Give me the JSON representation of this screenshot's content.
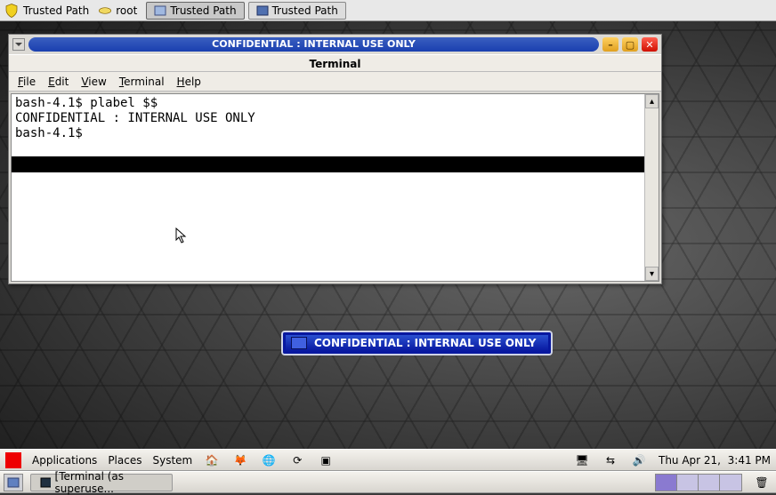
{
  "trustbar": {
    "label": "Trusted Path",
    "root_label": "root",
    "task1": "Trusted Path",
    "task2": "Trusted Path"
  },
  "window": {
    "security_label": "CONFIDENTIAL : INTERNAL USE ONLY",
    "subtitle": "Terminal",
    "menus": {
      "file": "File",
      "edit": "Edit",
      "view": "View",
      "terminal": "Terminal",
      "help": "Help"
    },
    "terminal_lines": [
      "bash-4.1$ plabel $$",
      "CONFIDENTIAL : INTERNAL USE ONLY",
      "bash-4.1$"
    ]
  },
  "badge": {
    "text": "CONFIDENTIAL : INTERNAL USE ONLY"
  },
  "panel": {
    "applications": "Applications",
    "places": "Places",
    "system": "System",
    "clock_day": "Thu Apr 21,",
    "clock_time": "3:41 PM"
  },
  "taskbar": {
    "task_label": "[Terminal (as superuse..."
  }
}
